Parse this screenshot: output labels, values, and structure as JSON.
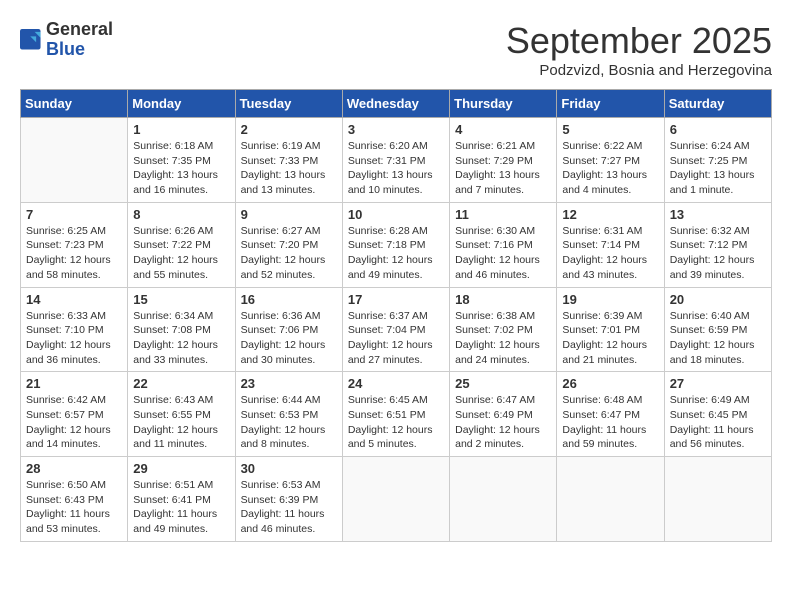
{
  "logo": {
    "general": "General",
    "blue": "Blue"
  },
  "title": "September 2025",
  "location": "Podzvizd, Bosnia and Herzegovina",
  "days_of_week": [
    "Sunday",
    "Monday",
    "Tuesday",
    "Wednesday",
    "Thursday",
    "Friday",
    "Saturday"
  ],
  "weeks": [
    [
      {
        "day": "",
        "info": ""
      },
      {
        "day": "1",
        "info": "Sunrise: 6:18 AM\nSunset: 7:35 PM\nDaylight: 13 hours\nand 16 minutes."
      },
      {
        "day": "2",
        "info": "Sunrise: 6:19 AM\nSunset: 7:33 PM\nDaylight: 13 hours\nand 13 minutes."
      },
      {
        "day": "3",
        "info": "Sunrise: 6:20 AM\nSunset: 7:31 PM\nDaylight: 13 hours\nand 10 minutes."
      },
      {
        "day": "4",
        "info": "Sunrise: 6:21 AM\nSunset: 7:29 PM\nDaylight: 13 hours\nand 7 minutes."
      },
      {
        "day": "5",
        "info": "Sunrise: 6:22 AM\nSunset: 7:27 PM\nDaylight: 13 hours\nand 4 minutes."
      },
      {
        "day": "6",
        "info": "Sunrise: 6:24 AM\nSunset: 7:25 PM\nDaylight: 13 hours\nand 1 minute."
      }
    ],
    [
      {
        "day": "7",
        "info": "Sunrise: 6:25 AM\nSunset: 7:23 PM\nDaylight: 12 hours\nand 58 minutes."
      },
      {
        "day": "8",
        "info": "Sunrise: 6:26 AM\nSunset: 7:22 PM\nDaylight: 12 hours\nand 55 minutes."
      },
      {
        "day": "9",
        "info": "Sunrise: 6:27 AM\nSunset: 7:20 PM\nDaylight: 12 hours\nand 52 minutes."
      },
      {
        "day": "10",
        "info": "Sunrise: 6:28 AM\nSunset: 7:18 PM\nDaylight: 12 hours\nand 49 minutes."
      },
      {
        "day": "11",
        "info": "Sunrise: 6:30 AM\nSunset: 7:16 PM\nDaylight: 12 hours\nand 46 minutes."
      },
      {
        "day": "12",
        "info": "Sunrise: 6:31 AM\nSunset: 7:14 PM\nDaylight: 12 hours\nand 43 minutes."
      },
      {
        "day": "13",
        "info": "Sunrise: 6:32 AM\nSunset: 7:12 PM\nDaylight: 12 hours\nand 39 minutes."
      }
    ],
    [
      {
        "day": "14",
        "info": "Sunrise: 6:33 AM\nSunset: 7:10 PM\nDaylight: 12 hours\nand 36 minutes."
      },
      {
        "day": "15",
        "info": "Sunrise: 6:34 AM\nSunset: 7:08 PM\nDaylight: 12 hours\nand 33 minutes."
      },
      {
        "day": "16",
        "info": "Sunrise: 6:36 AM\nSunset: 7:06 PM\nDaylight: 12 hours\nand 30 minutes."
      },
      {
        "day": "17",
        "info": "Sunrise: 6:37 AM\nSunset: 7:04 PM\nDaylight: 12 hours\nand 27 minutes."
      },
      {
        "day": "18",
        "info": "Sunrise: 6:38 AM\nSunset: 7:02 PM\nDaylight: 12 hours\nand 24 minutes."
      },
      {
        "day": "19",
        "info": "Sunrise: 6:39 AM\nSunset: 7:01 PM\nDaylight: 12 hours\nand 21 minutes."
      },
      {
        "day": "20",
        "info": "Sunrise: 6:40 AM\nSunset: 6:59 PM\nDaylight: 12 hours\nand 18 minutes."
      }
    ],
    [
      {
        "day": "21",
        "info": "Sunrise: 6:42 AM\nSunset: 6:57 PM\nDaylight: 12 hours\nand 14 minutes."
      },
      {
        "day": "22",
        "info": "Sunrise: 6:43 AM\nSunset: 6:55 PM\nDaylight: 12 hours\nand 11 minutes."
      },
      {
        "day": "23",
        "info": "Sunrise: 6:44 AM\nSunset: 6:53 PM\nDaylight: 12 hours\nand 8 minutes."
      },
      {
        "day": "24",
        "info": "Sunrise: 6:45 AM\nSunset: 6:51 PM\nDaylight: 12 hours\nand 5 minutes."
      },
      {
        "day": "25",
        "info": "Sunrise: 6:47 AM\nSunset: 6:49 PM\nDaylight: 12 hours\nand 2 minutes."
      },
      {
        "day": "26",
        "info": "Sunrise: 6:48 AM\nSunset: 6:47 PM\nDaylight: 11 hours\nand 59 minutes."
      },
      {
        "day": "27",
        "info": "Sunrise: 6:49 AM\nSunset: 6:45 PM\nDaylight: 11 hours\nand 56 minutes."
      }
    ],
    [
      {
        "day": "28",
        "info": "Sunrise: 6:50 AM\nSunset: 6:43 PM\nDaylight: 11 hours\nand 53 minutes."
      },
      {
        "day": "29",
        "info": "Sunrise: 6:51 AM\nSunset: 6:41 PM\nDaylight: 11 hours\nand 49 minutes."
      },
      {
        "day": "30",
        "info": "Sunrise: 6:53 AM\nSunset: 6:39 PM\nDaylight: 11 hours\nand 46 minutes."
      },
      {
        "day": "",
        "info": ""
      },
      {
        "day": "",
        "info": ""
      },
      {
        "day": "",
        "info": ""
      },
      {
        "day": "",
        "info": ""
      }
    ]
  ]
}
